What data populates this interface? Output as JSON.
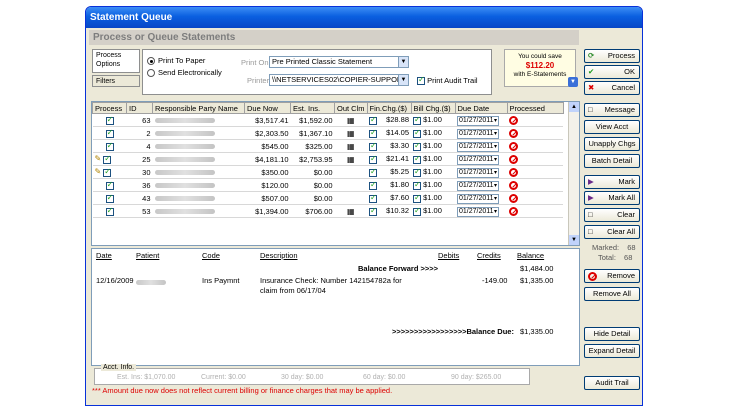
{
  "window": {
    "title": "Statement Queue",
    "subtitle": "Process or Queue Statements"
  },
  "tabs": {
    "process_options": "Process Options",
    "filters": "Filters"
  },
  "options": {
    "print_to_paper": "Print To Paper",
    "send_electronically": "Send Electronically",
    "print_on_label": "Print On:",
    "print_on_value": "Pre Printed Classic Statement",
    "printer_label": "Printer:",
    "printer_value": "\\\\NETSERVICES02\\COPIER-SUPPOR",
    "print_audit_trail": "Print Audit Trail"
  },
  "savings": {
    "line1": "You could save",
    "amount": "$112.20",
    "line2": "with E-Statements"
  },
  "buttons": {
    "process": "Process",
    "ok": "OK",
    "cancel": "Cancel",
    "message": "Message",
    "view_acct": "View Acct",
    "unapply_chgs": "Unapply Chgs",
    "batch_detail": "Batch Detail",
    "mark": "Mark",
    "mark_all": "Mark All",
    "clear": "Clear",
    "clear_all": "Clear All",
    "remove": "Remove",
    "remove_all": "Remove All",
    "hide_detail": "Hide Detail",
    "expand_detail": "Expand Detail",
    "audit_trail": "Audit Trail"
  },
  "counts": {
    "marked_label": "Marked:",
    "marked": "68",
    "total_label": "Total:",
    "total": "68"
  },
  "grid": {
    "headers": [
      "Process",
      "ID",
      "Responsible Party Name",
      "Due Now",
      "Est. Ins.",
      "Out Clm",
      "Fin.Chg.($)",
      "Bill Chg.($)",
      "Due Date",
      "Processed"
    ],
    "rows": [
      {
        "id": "63",
        "due": "$3,517.41",
        "ins": "$1,592.00",
        "clm": true,
        "fin": "$28.88",
        "bill": "$1.00",
        "date": "01/27/2011",
        "edit": false
      },
      {
        "id": "2",
        "due": "$2,303.50",
        "ins": "$1,367.10",
        "clm": true,
        "fin": "$14.05",
        "bill": "$1.00",
        "date": "01/27/2011",
        "edit": false
      },
      {
        "id": "4",
        "due": "$545.00",
        "ins": "$325.00",
        "clm": true,
        "fin": "$3.30",
        "bill": "$1.00",
        "date": "01/27/2011",
        "edit": false
      },
      {
        "id": "25",
        "due": "$4,181.10",
        "ins": "$2,753.95",
        "clm": true,
        "fin": "$21.41",
        "bill": "$1.00",
        "date": "01/27/2011",
        "edit": true
      },
      {
        "id": "30",
        "due": "$350.00",
        "ins": "$0.00",
        "clm": false,
        "fin": "$5.25",
        "bill": "$1.00",
        "date": "01/27/2011",
        "edit": true
      },
      {
        "id": "36",
        "due": "$120.00",
        "ins": "$0.00",
        "clm": false,
        "fin": "$1.80",
        "bill": "$1.00",
        "date": "01/27/2011",
        "edit": false
      },
      {
        "id": "43",
        "due": "$507.00",
        "ins": "$0.00",
        "clm": false,
        "fin": "$7.60",
        "bill": "$1.00",
        "date": "01/27/2011",
        "edit": false
      },
      {
        "id": "53",
        "due": "$1,394.00",
        "ins": "$706.00",
        "clm": true,
        "fin": "$10.32",
        "bill": "$1.00",
        "date": "01/27/2011",
        "edit": false
      }
    ]
  },
  "ledger": {
    "headers": {
      "date": "Date",
      "patient": "Patient",
      "code": "Code",
      "description": "Description",
      "debits": "Debits",
      "credits": "Credits",
      "balance": "Balance"
    },
    "balance_forward_label": "Balance Forward >>>>",
    "balance_forward_value": "$1,484.00",
    "entry": {
      "date": "12/16/2009",
      "code": "Ins Paymnt",
      "description": "Insurance Check:  Number 142154782a for claim from 06/17/04",
      "credits": "-149.00",
      "balance": "$1,335.00"
    },
    "balance_due_label": ">>>>>>>>>>>>>>>>>Balance Due:",
    "balance_due_value": "$1,335.00"
  },
  "acct_info": {
    "title": "Acct. Info.",
    "est_ins": "Est. Ins: $1,070.00",
    "current": "Current: $0.00",
    "d30": "30 day: $0.00",
    "d60": "60 day: $0.00",
    "d90": "90 day: $265.00"
  },
  "footnote": "*** Amount due now does not reflect current billing or finance charges that may be applied."
}
